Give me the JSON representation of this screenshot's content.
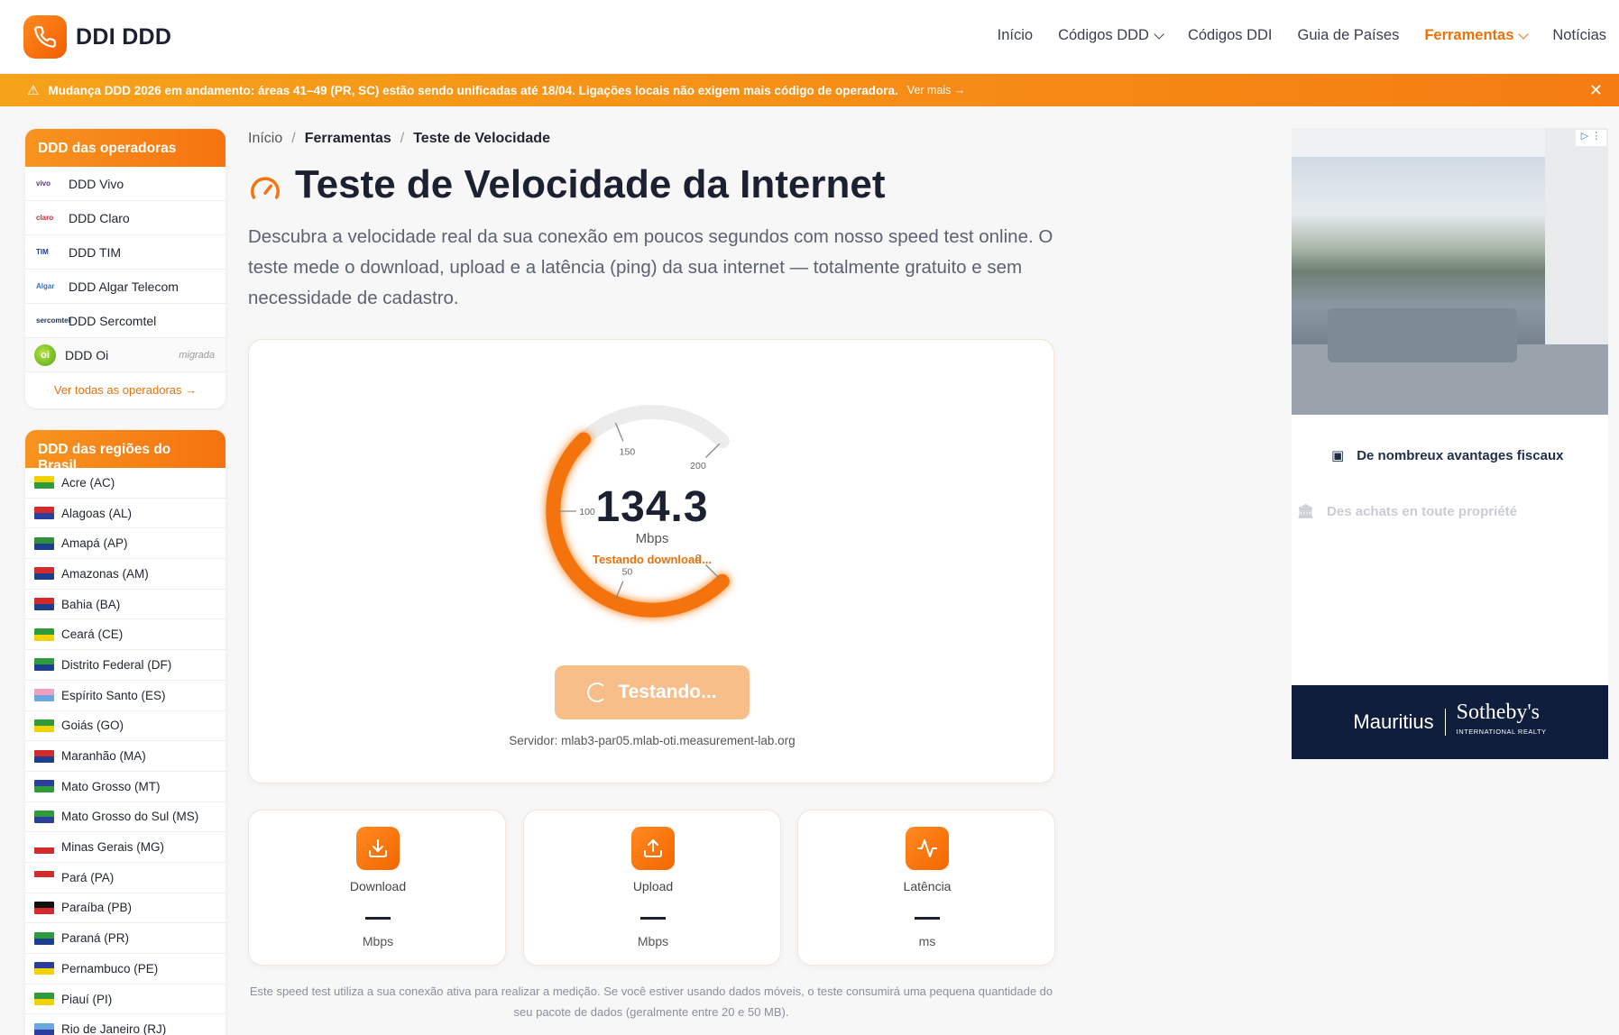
{
  "header": {
    "brand": "DDI DDD",
    "nav": [
      {
        "label": "Início",
        "dropdown": false,
        "active": false
      },
      {
        "label": "Códigos DDD",
        "dropdown": true,
        "active": false
      },
      {
        "label": "Códigos DDI",
        "dropdown": false,
        "active": false
      },
      {
        "label": "Guia de Países",
        "dropdown": false,
        "active": false
      },
      {
        "label": "Ferramentas",
        "dropdown": true,
        "active": true
      },
      {
        "label": "Notícias",
        "dropdown": false,
        "active": false
      }
    ]
  },
  "banner": {
    "text": "Mudança DDD 2026 em andamento: áreas 41–49 (PR, SC) estão sendo unificadas até 18/04. Ligações locais não exigem mais código de operadora.",
    "link": "Ver mais →",
    "close": "✕"
  },
  "sidebar": {
    "operators_title": "DDD das operadoras",
    "operators": [
      {
        "logo": "vivo",
        "label": "DDD Vivo",
        "color": "#6b2c91"
      },
      {
        "logo": "claro",
        "label": "DDD Claro",
        "color": "#d8262b"
      },
      {
        "logo": "TIM",
        "label": "DDD TIM",
        "color": "#1b3e8f"
      },
      {
        "logo": "Algar",
        "label": "DDD Algar Telecom",
        "color": "#3a6fb0"
      },
      {
        "logo": "sercomtel",
        "label": "DDD Sercomtel",
        "color": "#1d3557"
      },
      {
        "logo": "oi",
        "label": "DDD Oi",
        "tag": "migrada"
      }
    ],
    "see_all": "Ver todas as operadoras →",
    "regions_title": "DDD das regiões do Brasil",
    "regions": [
      {
        "label": "Acre (AC)",
        "colors": [
          "#f2d200",
          "#2f9b3a"
        ]
      },
      {
        "label": "Alagoas (AL)",
        "colors": [
          "#d22b2b",
          "#2a3f9c"
        ]
      },
      {
        "label": "Amapá (AP)",
        "colors": [
          "#2f8f3a",
          "#1d3d8f"
        ]
      },
      {
        "label": "Amazonas (AM)",
        "colors": [
          "#d22b2b",
          "#1d3d8f"
        ]
      },
      {
        "label": "Bahia (BA)",
        "colors": [
          "#d22b2b",
          "#1d3d8f"
        ]
      },
      {
        "label": "Ceará (CE)",
        "colors": [
          "#2f9b3a",
          "#f2d200"
        ]
      },
      {
        "label": "Distrito Federal (DF)",
        "colors": [
          "#2f9b3a",
          "#1d3d8f"
        ]
      },
      {
        "label": "Espírito Santo (ES)",
        "colors": [
          "#f39fc0",
          "#6aa7e0"
        ]
      },
      {
        "label": "Goiás (GO)",
        "colors": [
          "#2f9b3a",
          "#f2d200"
        ]
      },
      {
        "label": "Maranhão (MA)",
        "colors": [
          "#d22b2b",
          "#1d3d8f"
        ]
      },
      {
        "label": "Mato Grosso (MT)",
        "colors": [
          "#2a3f9c",
          "#2f9b3a"
        ]
      },
      {
        "label": "Mato Grosso do Sul (MS)",
        "colors": [
          "#2f9b3a",
          "#2a3f9c"
        ]
      },
      {
        "label": "Minas Gerais (MG)",
        "colors": [
          "#ffffff",
          "#d22b2b"
        ]
      },
      {
        "label": "Pará (PA)",
        "colors": [
          "#d22b2b",
          "#ffffff"
        ]
      },
      {
        "label": "Paraíba (PB)",
        "colors": [
          "#111111",
          "#d22b2b"
        ]
      },
      {
        "label": "Paraná (PR)",
        "colors": [
          "#2f9b3a",
          "#1d3d8f"
        ]
      },
      {
        "label": "Pernambuco (PE)",
        "colors": [
          "#2a3f9c",
          "#f2d200"
        ]
      },
      {
        "label": "Piauí (PI)",
        "colors": [
          "#2f9b3a",
          "#f2d200"
        ]
      },
      {
        "label": "Rio de Janeiro (RJ)",
        "colors": [
          "#6aa7e0",
          "#2a3f9c"
        ]
      }
    ]
  },
  "breadcrumb": {
    "home": "Início",
    "section": "Ferramentas",
    "current": "Teste de Velocidade",
    "sep": "/"
  },
  "page": {
    "title": "Teste de Velocidade da Internet",
    "lead": "Descubra a velocidade real da sua conexão em poucos segundos com nosso speed test online. O teste mede o download, upload e a latência (ping) da sua internet — totalmente gratuito e sem necessidade de cadastro."
  },
  "meter": {
    "value": "134.3",
    "value_num": 134.3,
    "max": 200,
    "unit": "Mbps",
    "status": "Testando download...",
    "ticks": [
      "0",
      "50",
      "100",
      "150",
      "200"
    ],
    "button": "Testando...",
    "server": "Servidor: mlab3-par05.mlab-oti.measurement-lab.org"
  },
  "stats": [
    {
      "label": "Download",
      "value": "—",
      "unit": "Mbps",
      "icon": "download-icon"
    },
    {
      "label": "Upload",
      "value": "—",
      "unit": "Mbps",
      "icon": "upload-icon"
    },
    {
      "label": "Latência",
      "value": "—",
      "unit": "ms",
      "icon": "activity-icon"
    }
  ],
  "note": "Este speed test utiliza a sua conexão ativa para realizar a medição. Se você estiver usando dados móveis, o teste consumirá uma pequena quantidade do seu pacote de dados (geralmente entre 20 e 50 MB).",
  "ad": {
    "line1": "De nombreux avantages fiscaux",
    "line2": "Des achats en toute propriété",
    "brand_a": "Mauritius",
    "brand_b": "Sotheby's",
    "brand_sub": "INTERNATIONAL REALTY"
  },
  "colors": {
    "accent": "#f57310",
    "accent_light": "#f8be8a",
    "text": "#1b2130"
  }
}
